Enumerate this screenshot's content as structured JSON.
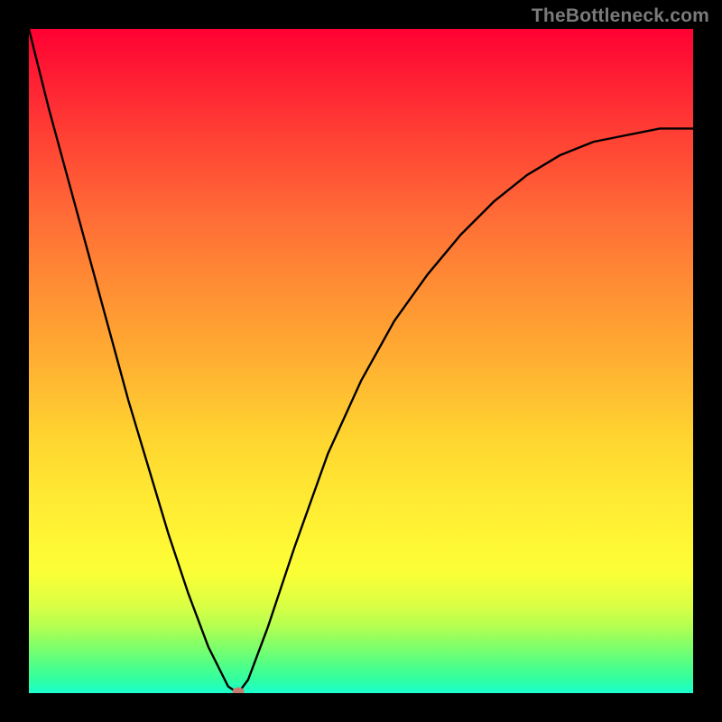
{
  "watermark": "TheBottleneck.com",
  "colors": {
    "gradient_top": "#ff0033",
    "gradient_mid": "#ffd630",
    "gradient_bottom": "#19ffcf",
    "curve": "#000000",
    "dot": "#c77a72",
    "frame": "#000000"
  },
  "chart_data": {
    "type": "line",
    "title": "",
    "xlabel": "",
    "ylabel": "",
    "xlim": [
      0,
      100
    ],
    "ylim": [
      0,
      100
    ],
    "grid": false,
    "legend": false,
    "x": [
      0,
      3,
      6,
      9,
      12,
      15,
      18,
      21,
      24,
      27,
      30,
      31.5,
      33,
      36,
      40,
      45,
      50,
      55,
      60,
      65,
      70,
      75,
      80,
      85,
      90,
      95,
      100
    ],
    "y": [
      100,
      88,
      77,
      66,
      55,
      44,
      34,
      24,
      15,
      7,
      1,
      0,
      2,
      10,
      22,
      36,
      47,
      56,
      63,
      69,
      74,
      78,
      81,
      83,
      84,
      85,
      85
    ],
    "marker": {
      "x": 31.5,
      "y": 0.3
    },
    "notes": "V-shaped curve on a vertical rainbow gradient; curve stroke black; small reddish dot at minimum."
  }
}
